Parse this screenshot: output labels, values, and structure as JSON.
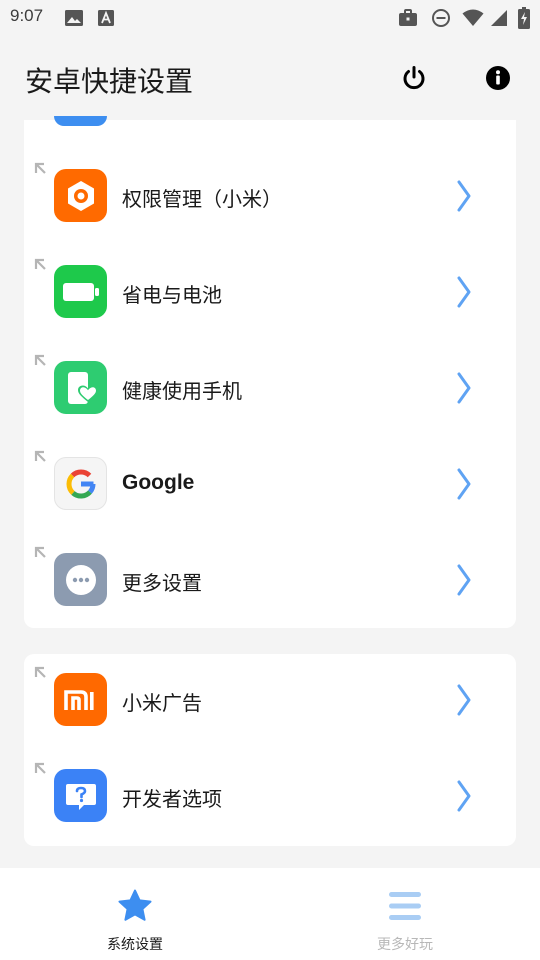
{
  "status_bar": {
    "time": "9:07",
    "icons": [
      "image-icon",
      "font-icon",
      "briefcase-icon",
      "dnd-icon",
      "wifi-icon",
      "signal-icon",
      "battery-charging-icon"
    ]
  },
  "app_bar": {
    "title": "安卓快捷设置",
    "actions": [
      "power-icon",
      "info-icon"
    ]
  },
  "groups": [
    {
      "items": [
        {
          "label": "权限管理（小米）",
          "icon": "permission-hexagon-icon",
          "color": "#ff6a00"
        },
        {
          "label": "省电与电池",
          "icon": "battery-icon",
          "color": "#1ec94b"
        },
        {
          "label": "健康使用手机",
          "icon": "phone-heart-icon",
          "color": "#2ecc71"
        },
        {
          "label": "Google",
          "icon": "google-icon",
          "color": "#f5f5f5"
        },
        {
          "label": "更多设置",
          "icon": "more-dots-icon",
          "color": "#8c9bb0"
        }
      ]
    },
    {
      "items": [
        {
          "label": "小米广告",
          "icon": "mi-logo-icon",
          "color": "#ff6900"
        },
        {
          "label": "开发者选项",
          "icon": "help-bubble-icon",
          "color": "#3b82f6"
        }
      ]
    }
  ],
  "bottom_nav": {
    "items": [
      {
        "label": "系统设置",
        "icon": "star-icon",
        "active": true
      },
      {
        "label": "更多好玩",
        "icon": "menu-icon",
        "active": false
      }
    ]
  },
  "colors": {
    "accent": "#3d8ef0",
    "chevron": "#5fa3f3",
    "background": "#f4f4f4",
    "card": "#ffffff",
    "inactive": "#b8b8b8"
  }
}
